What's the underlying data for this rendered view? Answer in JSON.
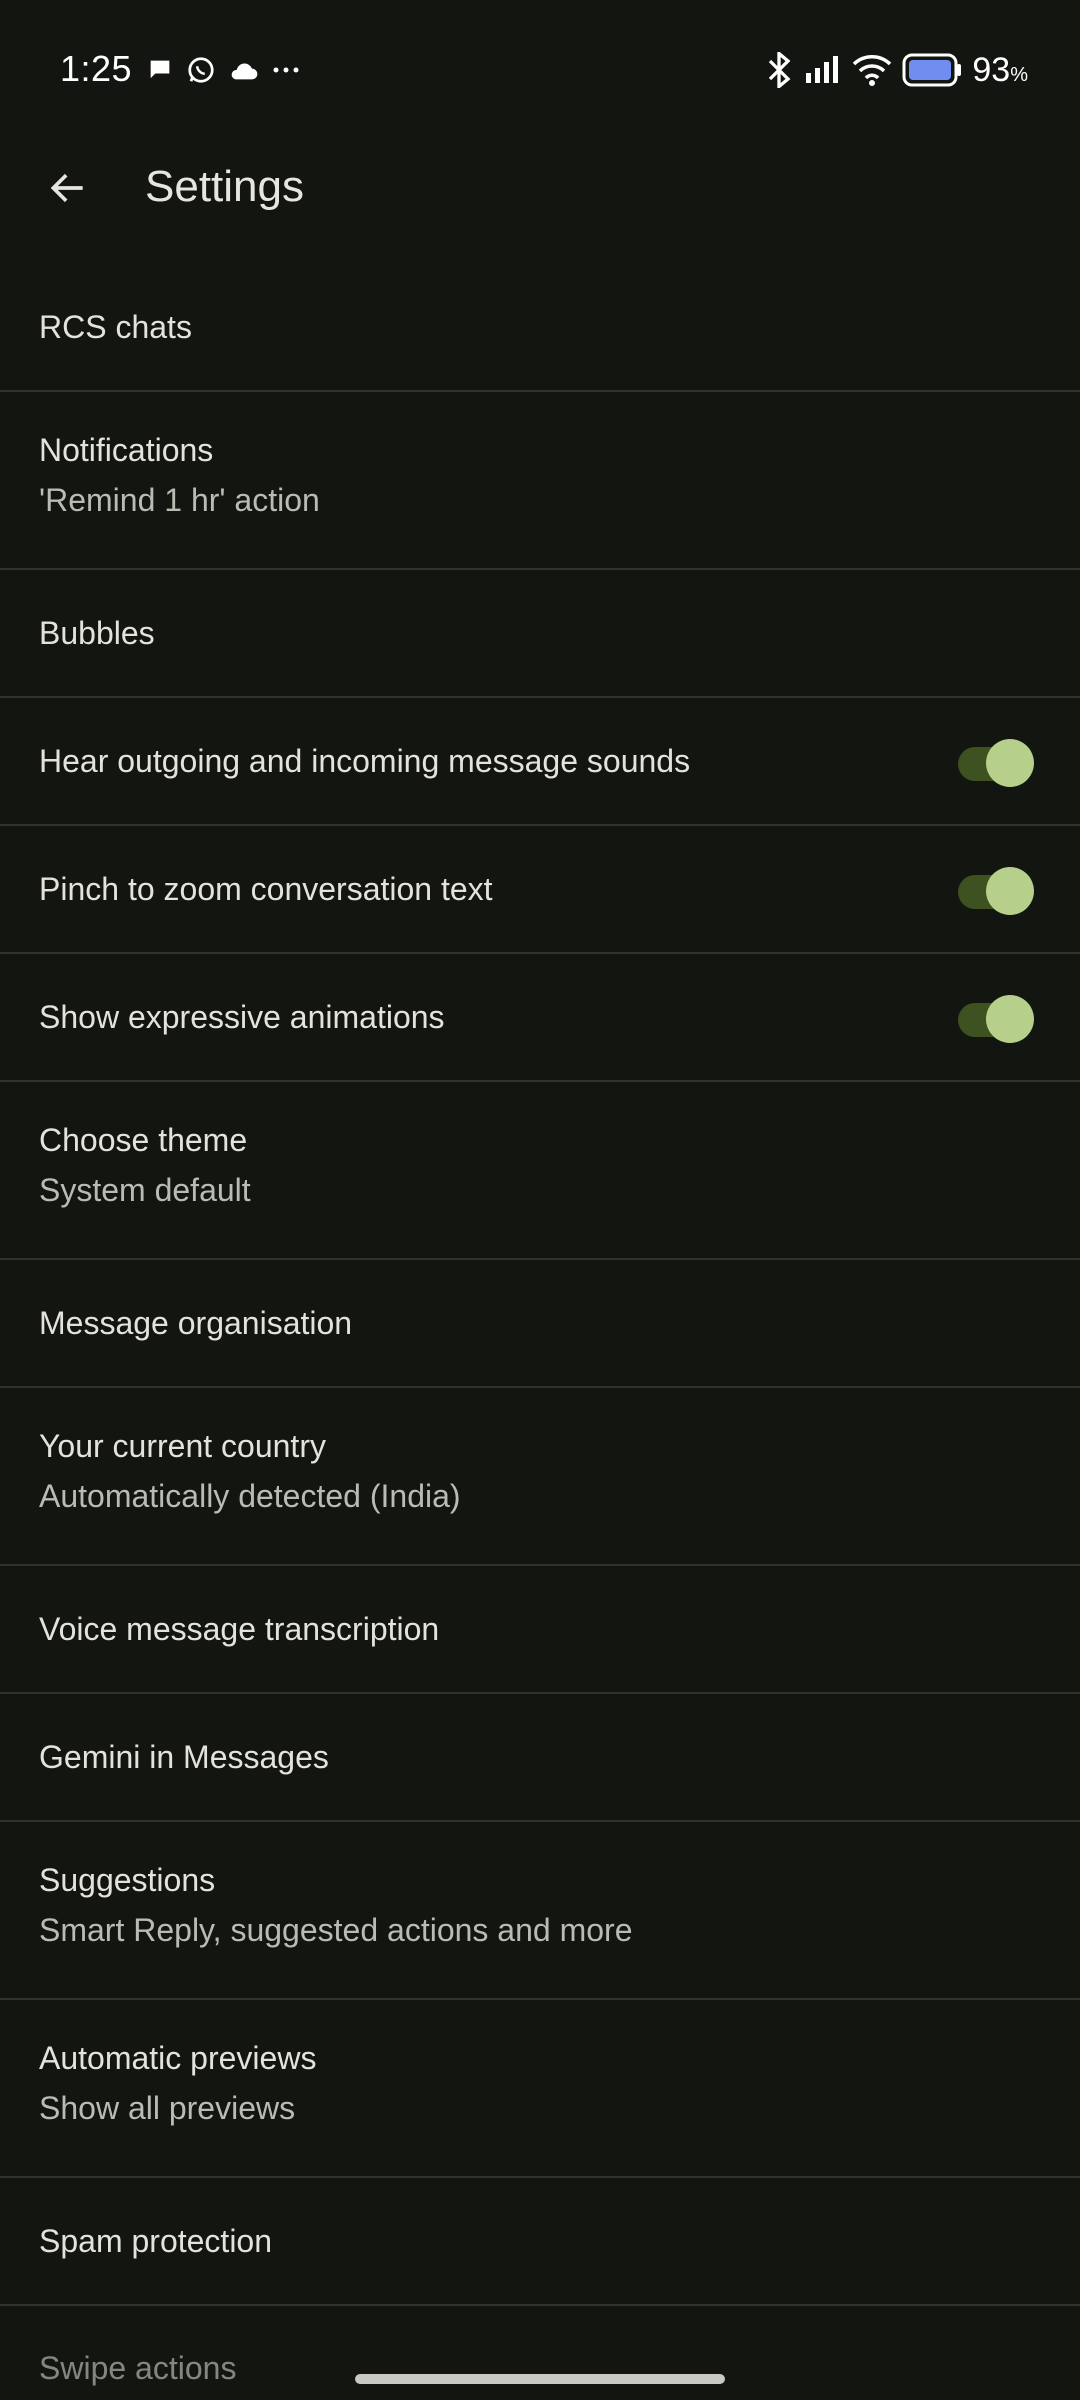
{
  "status_bar": {
    "time": "1:25",
    "battery_percent": "93",
    "battery_unit": "%",
    "left_icons": [
      "chat-bubble-icon",
      "whatsapp-icon",
      "cloud-icon",
      "more-dots-icon"
    ],
    "right_icons": [
      "bluetooth-icon",
      "signal-icon",
      "wifi-icon",
      "battery-icon"
    ]
  },
  "app_bar": {
    "title": "Settings",
    "back_icon": "arrow-back-icon"
  },
  "settings": [
    {
      "title": "RCS chats"
    },
    {
      "title": "Notifications",
      "subtitle": "'Remind 1 hr' action"
    },
    {
      "title": "Bubbles"
    },
    {
      "title": "Hear outgoing and incoming message sounds",
      "toggle": true
    },
    {
      "title": "Pinch to zoom conversation text",
      "toggle": true
    },
    {
      "title": "Show expressive animations",
      "toggle": true
    },
    {
      "title": "Choose theme",
      "subtitle": "System default"
    },
    {
      "title": "Message organisation"
    },
    {
      "title": "Your current country",
      "subtitle": "Automatically detected (India)"
    },
    {
      "title": "Voice message transcription"
    },
    {
      "title": "Gemini in Messages"
    },
    {
      "title": "Suggestions",
      "subtitle": "Smart Reply, suggested actions and more"
    },
    {
      "title": "Automatic previews",
      "subtitle": "Show all previews"
    },
    {
      "title": "Spam protection"
    }
  ],
  "partial_row": "Swipe actions",
  "colors": {
    "background": "#131511",
    "toggle_track": "#3d5220",
    "toggle_thumb": "#b6d08b",
    "divider": "#2f322d",
    "battery_fill": "#6f8ef0"
  }
}
